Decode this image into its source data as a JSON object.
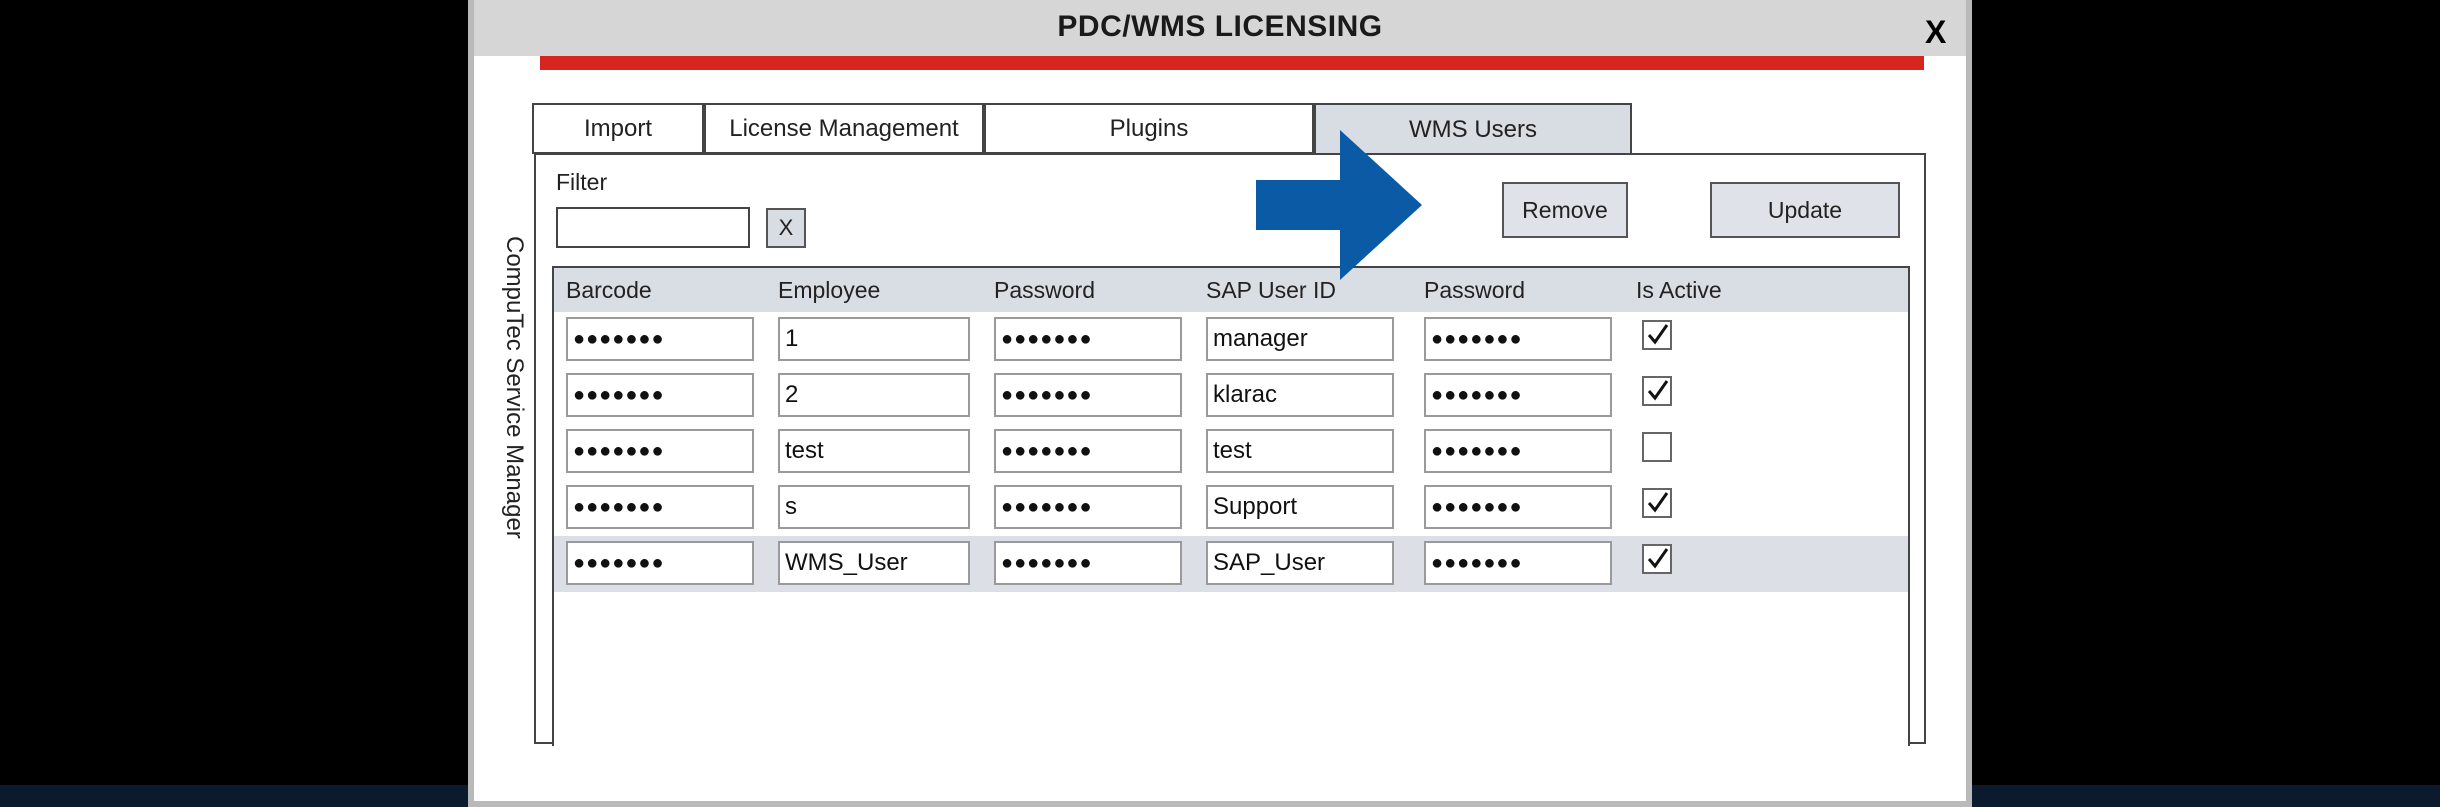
{
  "window": {
    "title": "PDC/WMS LICENSING",
    "close_label": "X"
  },
  "side_label": "CompuTec Service Manager",
  "tabs": [
    {
      "label": "Import",
      "active": false
    },
    {
      "label": "License Management",
      "active": false
    },
    {
      "label": "Plugins",
      "active": false
    },
    {
      "label": "WMS Users",
      "active": true
    }
  ],
  "filter": {
    "label": "Filter",
    "value": "",
    "clear_label": "X"
  },
  "buttons": {
    "remove": "Remove",
    "update": "Update"
  },
  "table": {
    "columns": [
      "Barcode",
      "Employee",
      "Password",
      "SAP User ID",
      "Password",
      "Is Active"
    ],
    "rows": [
      {
        "barcode": "●●●●●●●",
        "employee": "1",
        "password": "●●●●●●●",
        "sap_user_id": "manager",
        "sap_password": "●●●●●●●",
        "is_active": true
      },
      {
        "barcode": "●●●●●●●",
        "employee": "2",
        "password": "●●●●●●●",
        "sap_user_id": "klarac",
        "sap_password": "●●●●●●●",
        "is_active": true
      },
      {
        "barcode": "●●●●●●●",
        "employee": "test",
        "password": "●●●●●●●",
        "sap_user_id": "test",
        "sap_password": "●●●●●●●",
        "is_active": false
      },
      {
        "barcode": "●●●●●●●",
        "employee": "s",
        "password": "●●●●●●●",
        "sap_user_id": "Support",
        "sap_password": "●●●●●●●",
        "is_active": true
      },
      {
        "barcode": "●●●●●●●",
        "employee": "WMS_User",
        "password": "●●●●●●●",
        "sap_user_id": "SAP_User",
        "sap_password": "●●●●●●●",
        "is_active": true,
        "selected": true
      }
    ]
  },
  "annotation": {
    "icon": "arrow-right-icon",
    "color": "#0b5aa6"
  },
  "colors": {
    "accent_bar": "#d7261f",
    "header_bg": "#d9dde4",
    "title_bar": "#d6d6d6"
  }
}
